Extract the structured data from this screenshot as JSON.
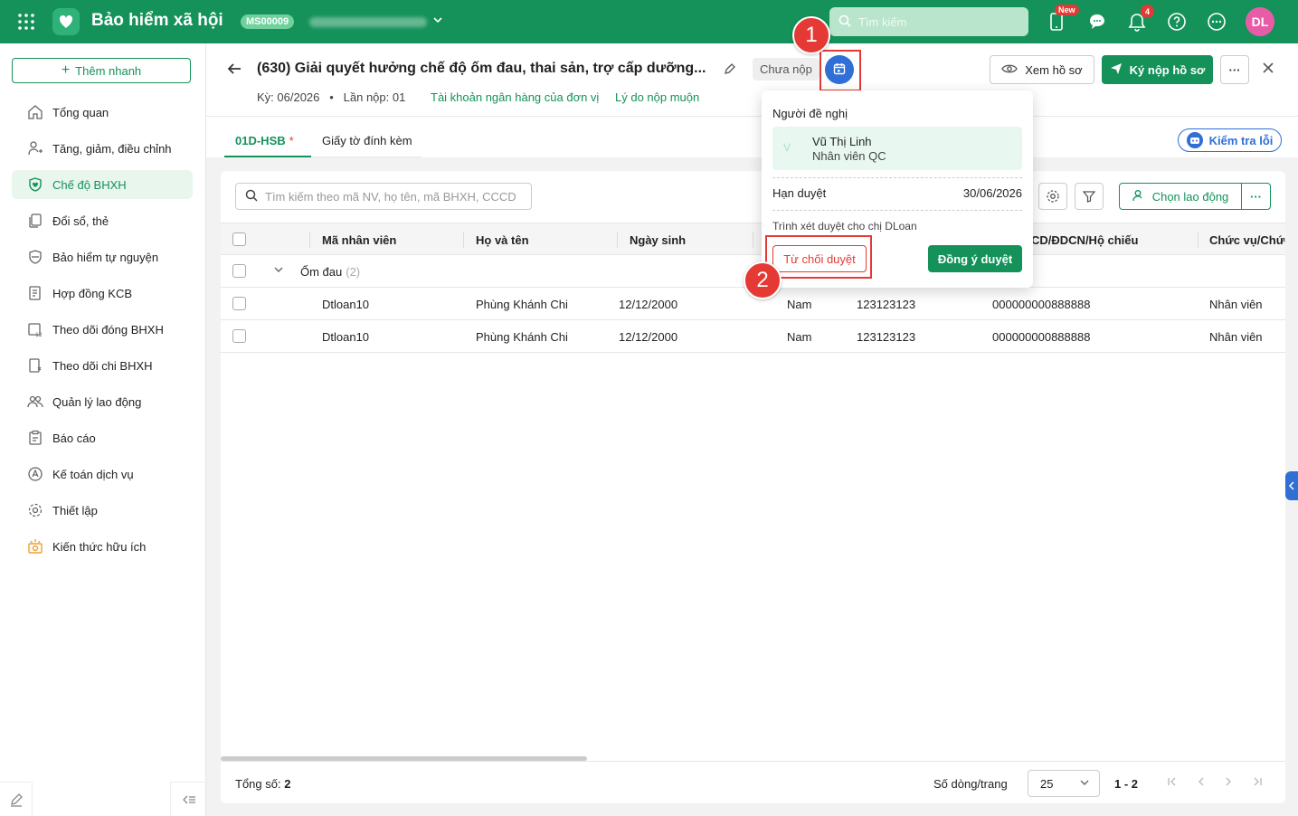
{
  "topbar": {
    "app_title": "Bảo hiểm xã hội",
    "org_code": "MS00009",
    "search_placeholder": "Tìm kiếm",
    "new_badge": "New",
    "notification_count": "4",
    "avatar_initials": "DL"
  },
  "sidebar": {
    "quick_add": "Thêm nhanh",
    "items": [
      {
        "label": "Tổng quan",
        "icon": "home-icon"
      },
      {
        "label": "Tăng, giảm, điều chỉnh",
        "icon": "user-adjust-icon"
      },
      {
        "label": "Chế độ BHXH",
        "icon": "shield-heart-icon"
      },
      {
        "label": "Đổi sổ, thẻ",
        "icon": "cards-icon"
      },
      {
        "label": "Bảo hiểm tự nguyện",
        "icon": "shield-icon"
      },
      {
        "label": "Hợp đồng KCB",
        "icon": "contract-icon"
      },
      {
        "label": "Theo dõi đóng BHXH",
        "icon": "calendar-track-icon"
      },
      {
        "label": "Theo dõi chi BHXH",
        "icon": "document-track-icon"
      },
      {
        "label": "Quản lý lao động",
        "icon": "people-icon"
      },
      {
        "label": "Báo cáo",
        "icon": "clipboard-icon"
      },
      {
        "label": "Kế toán dịch vụ",
        "icon": "accounting-icon"
      },
      {
        "label": "Thiết lập",
        "icon": "gear-icon"
      },
      {
        "label": "Kiến thức hữu ích",
        "icon": "knowledge-icon"
      }
    ]
  },
  "header": {
    "title": "(630) Giải quyết hưởng chế độ ốm đau, thai sản, trợ cấp dưỡng...",
    "status": "Chưa nộp",
    "period": "Kỳ: 06/2026",
    "submission": "Lần nộp: 01",
    "bank_link": "Tài khoản ngân hàng của đơn vị",
    "late_link": "Lý do nộp muộn",
    "view_button": "Xem hồ sơ",
    "sign_button": "Ký nộp hồ sơ"
  },
  "tabs": {
    "form_tab": "01D-HSB",
    "required_mark": "*",
    "attachments_tab": "Giấy tờ đính kèm",
    "check_button": "Kiểm tra lỗi"
  },
  "table": {
    "search_placeholder": "Tìm kiếm theo mã NV, họ tên, mã BHXH, CCCD",
    "choose_button": "Chọn lao động",
    "columns": [
      "Mã nhân viên",
      "Họ và tên",
      "Ngày sinh",
      "CD/ĐDCN/Hộ chiếu",
      "Chức vụ/Chức"
    ],
    "group": {
      "label": "Ốm đau",
      "count": "(2)"
    },
    "rows": [
      {
        "code": "Dtloan10",
        "name": "Phùng Khánh Chi",
        "dob": "12/12/2000",
        "gender": "Nam",
        "bhxh": "123123123",
        "id_no": "000000000888888",
        "position": "Nhân viên"
      },
      {
        "code": "Dtloan10",
        "name": "Phùng Khánh Chi",
        "dob": "12/12/2000",
        "gender": "Nam",
        "bhxh": "123123123",
        "id_no": "000000000888888",
        "position": "Nhân viên"
      }
    ],
    "footer": {
      "total_label": "Tổng số:",
      "total_value": "2",
      "rows_per_page_label": "Số dòng/trang",
      "rows_per_page": "25",
      "range": "1 - 2"
    }
  },
  "popover": {
    "proposer_label": "Người đề nghị",
    "proposer_avatar": "V",
    "proposer_name": "Vũ Thị Linh",
    "proposer_role": "Nhân viên QC",
    "deadline_label": "Hạn duyệt",
    "deadline_value": "30/06/2026",
    "note": "Trình xét duyệt cho chị DLoan",
    "reject_button": "Từ chối duyệt",
    "approve_button": "Đồng ý duyệt"
  },
  "markers": {
    "one": "1",
    "two": "2"
  },
  "colors": {
    "brand": "#14925a",
    "accent_blue": "#2f6fd6",
    "danger": "#e53935"
  }
}
